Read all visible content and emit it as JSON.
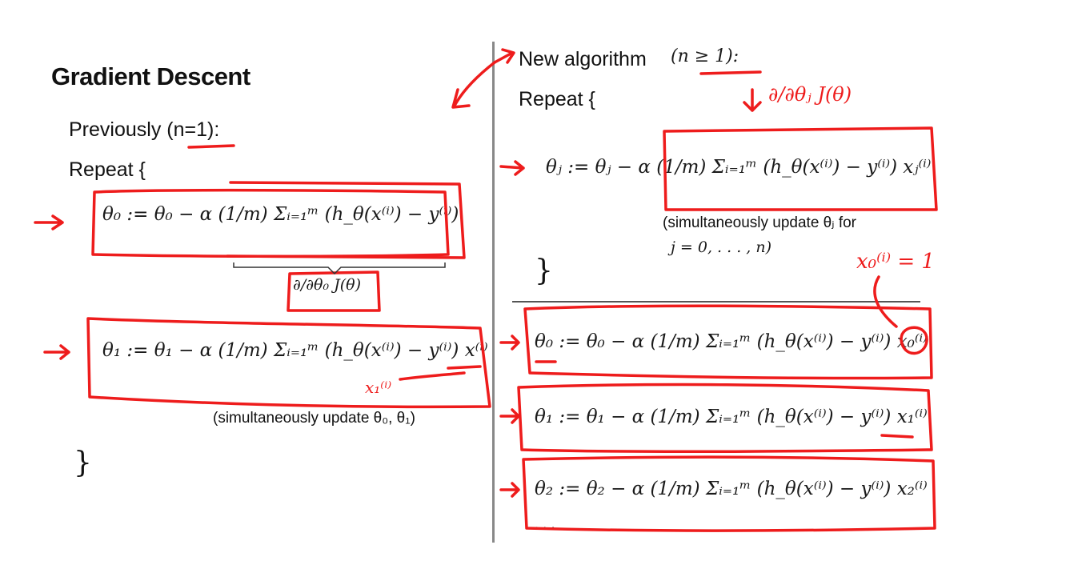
{
  "left": {
    "title": "Gradient Descent",
    "previously": "Previously (n=1):",
    "repeat": "Repeat {",
    "update_theta0": "θ₀ := θ₀ − α (1/m) Σᵢ₌₁ᵐ (h_θ(x⁽ⁱ⁾) − y⁽ⁱ⁾)",
    "partial_label": "∂/∂θ₀ J(θ)",
    "update_theta1": "θ₁ := θ₁ − α (1/m) Σᵢ₌₁ᵐ (h_θ(x⁽ⁱ⁾) − y⁽ⁱ⁾) x⁽ⁱ⁾",
    "simultaneous": "(simultaneously update θ₀, θ₁)",
    "close": "}"
  },
  "right": {
    "title": "New algorithm",
    "condition": "(n ≥ 1):",
    "repeat": "Repeat {",
    "update_thetaj": "θⱼ := θⱼ − α (1/m) Σᵢ₌₁ᵐ (h_θ(x⁽ⁱ⁾) − y⁽ⁱ⁾) xⱼ⁽ⁱ⁾",
    "simultaneous": "(simultaneously update θⱼ for",
    "range": "j = 0, . . . , n)",
    "close": "}",
    "examples": [
      "θ₀ := θ₀ − α (1/m) Σᵢ₌₁ᵐ (h_θ(x⁽ⁱ⁾) − y⁽ⁱ⁾) x₀⁽ⁱ⁾",
      "θ₁ := θ₁ − α (1/m) Σᵢ₌₁ᵐ (h_θ(x⁽ⁱ⁾) − y⁽ⁱ⁾) x₁⁽ⁱ⁾",
      "θ₂ := θ₂ − α (1/m) Σᵢ₌₁ᵐ (h_θ(x⁽ⁱ⁾) − y⁽ⁱ⁾) x₂⁽ⁱ⁾"
    ],
    "ellipsis": "· · ·"
  },
  "annotations": {
    "partial_j": "∂/∂θⱼ J(θ)",
    "x0_eq_1": "x₀⁽ⁱ⁾ = 1",
    "x1_note": "x₁⁽ⁱ⁾"
  },
  "colors": {
    "ink": "#ee1c1c",
    "divider": "#888888",
    "text": "#111111"
  }
}
